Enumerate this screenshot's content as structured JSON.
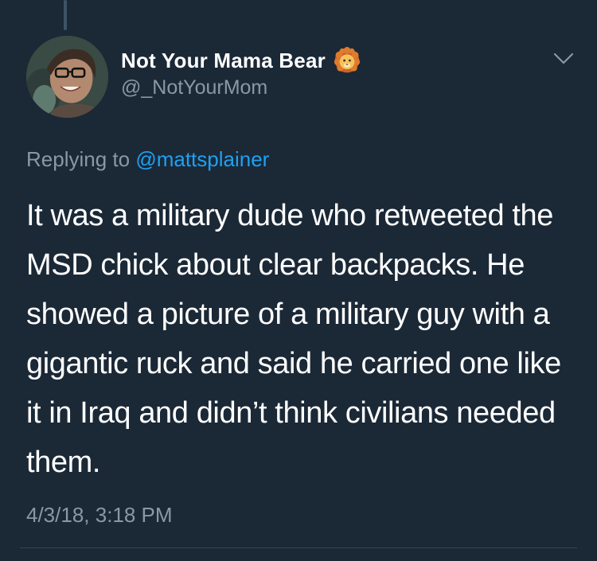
{
  "tweet": {
    "author": {
      "display_name": "Not Your Mama Bear",
      "handle": "@_NotYourMom",
      "name_emoji": "lion-face-icon"
    },
    "reply": {
      "prefix": "Replying to",
      "mention": "@mattsplainer"
    },
    "text": "It was a military dude who retweeted the MSD chick about clear backpacks. He showed a picture of a military guy with a gigantic ruck and said he carried one like it in Iraq and didn’t think civilians needed them.",
    "timestamp": "4/3/18, 3:18 PM",
    "menu_icon": "chevron-down-icon"
  },
  "colors": {
    "background": "#1b2836",
    "primary_text": "#ffffff",
    "secondary_text": "#8899a6",
    "link": "#1da1f2",
    "divider": "#38444d"
  }
}
